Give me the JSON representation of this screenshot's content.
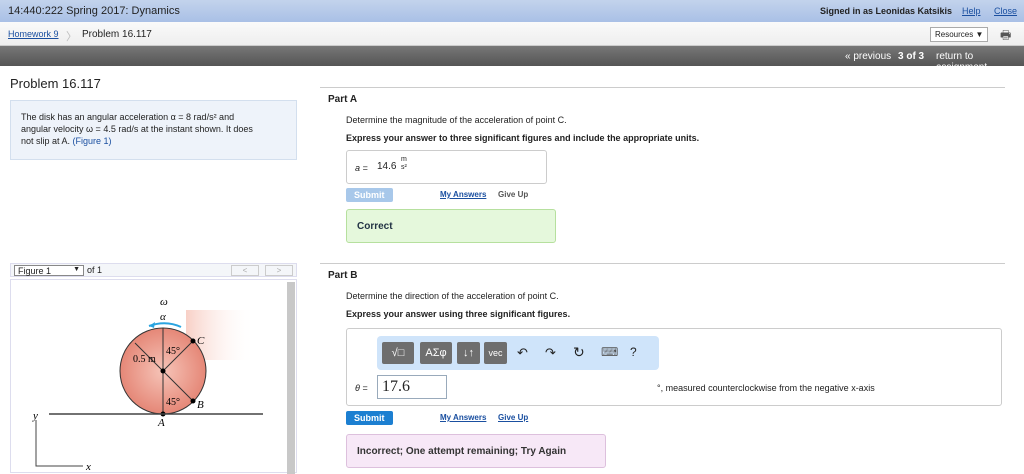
{
  "header": {
    "course": "14:440:222 Spring 2017: Dynamics",
    "signed_in": "Signed in as Leonidas Katsikis",
    "help": "Help",
    "close": "Close"
  },
  "breadcrumb": {
    "homework": "Homework 9",
    "problem": "Problem 16.117",
    "resources": "Resources ▼"
  },
  "nav": {
    "previous": "« previous",
    "position": "3 of 3",
    "return": "return to assignment"
  },
  "problem": {
    "title": "Problem 16.117",
    "text1": "The disk has an angular acceleration α = 8 rad/s² and",
    "text2": "angular velocity ω = 4.5 rad/s at the instant shown. It does",
    "text3": "not slip at A. ",
    "figure_link": "(Figure 1)"
  },
  "figure": {
    "select": "Figure 1",
    "of": "of 1",
    "prev": "<",
    "next": ">",
    "labels": {
      "omega": "ω",
      "alpha": "α",
      "radius": "0.5 m",
      "angle1": "45°",
      "angle2": "45°",
      "C": "C",
      "B": "B",
      "A": "A",
      "y": "y",
      "x": "x"
    }
  },
  "partA": {
    "title": "Part A",
    "prompt": "Determine the magnitude of the acceleration of point C.",
    "instruction": "Express your answer to three significant figures and include the appropriate units.",
    "var": "a =",
    "value": "14.6",
    "unit_num": "m",
    "unit_den": "s²",
    "submit": "Submit",
    "my_answers": "My Answers",
    "give_up": "Give Up",
    "result": "Correct"
  },
  "partB": {
    "title": "Part B",
    "prompt": "Determine the direction of the acceleration of point C.",
    "instruction": "Express your answer using three significant figures.",
    "toolbar": [
      "√□",
      "ΑΣφ",
      "↓↑",
      "vec",
      "↶",
      "↷",
      "↻",
      "⌨",
      "?"
    ],
    "var": "θ =",
    "value": "17.6",
    "suffix": "°, measured counterclockwise from the negative x-axis",
    "submit": "Submit",
    "my_answers": "My Answers",
    "give_up": "Give Up",
    "result": "Incorrect; One attempt remaining; Try Again"
  }
}
